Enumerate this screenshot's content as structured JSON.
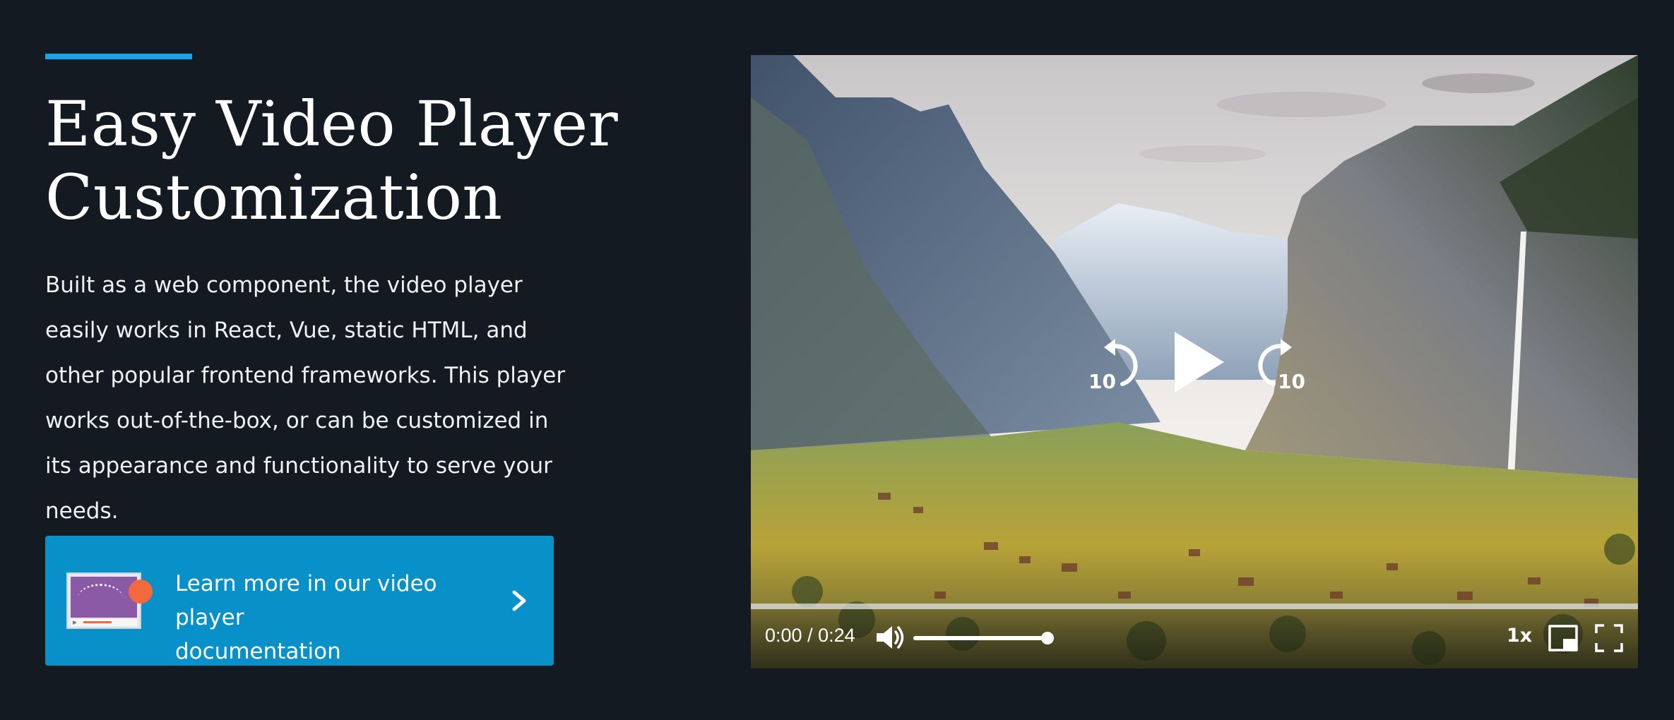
{
  "hero": {
    "title_line1": "Easy Video Player",
    "title_line2": "Customization",
    "description": "Built as a web component, the video player easily works in React, Vue, static HTML, and other popular frontend frameworks. This player works out-of-the-box, or can be customized in its appearance and functionality to serve your needs.",
    "accent_color": "#1aa3e8"
  },
  "cta": {
    "label_line1": "Learn more in our video player",
    "label_line2": "documentation",
    "background_color": "#0791c8",
    "icon": "video-player-thumbnail-icon",
    "chevron_icon": "chevron-right-icon"
  },
  "player": {
    "time_current": "0:00",
    "time_separator": " / ",
    "time_total": "0:24",
    "seek_back_seconds": "10",
    "seek_forward_seconds": "10",
    "playback_rate": "1x",
    "progress_fraction": 0,
    "volume_fraction": 1.0,
    "icons": {
      "seek_back": "replay-10-icon",
      "play": "play-icon",
      "seek_forward": "forward-10-icon",
      "volume": "volume-icon",
      "pip": "picture-in-picture-icon",
      "fullscreen": "fullscreen-icon"
    }
  }
}
